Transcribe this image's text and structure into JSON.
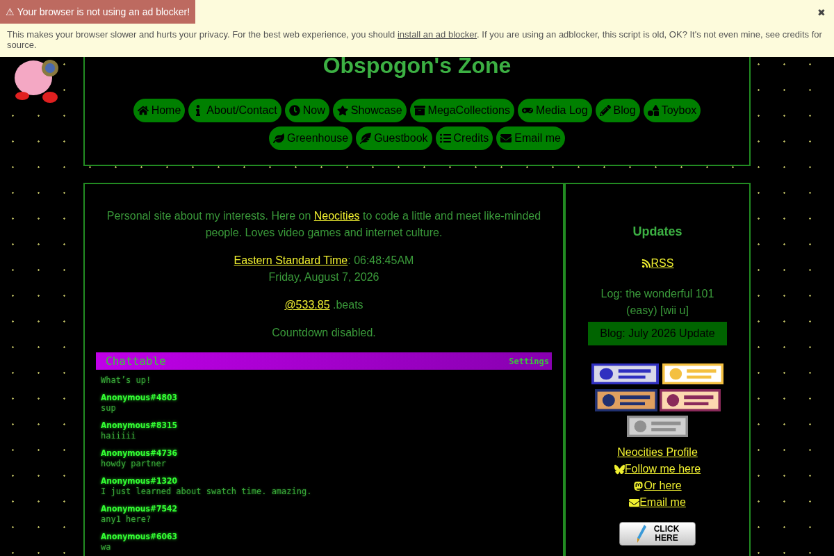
{
  "banner": {
    "title": "⚠ Your browser is not using an ad blocker!",
    "close": "✖",
    "text_before": "This makes your browser slower and hurts your privacy. For the best web experience, you should ",
    "link": "install an ad blocker",
    "text_after": ". If you are using an adblocker, this script is old, OK? It's not even mine, see credits for source."
  },
  "header": {
    "title": "Obspogon's Zone",
    "nav": [
      {
        "label": "Home"
      },
      {
        "label": "About/Contact"
      },
      {
        "label": "Now"
      },
      {
        "label": "Showcase"
      },
      {
        "label": "MegaCollections"
      },
      {
        "label": "Media Log"
      },
      {
        "label": "Blog"
      },
      {
        "label": "Toybox"
      },
      {
        "label": "Greenhouse"
      },
      {
        "label": "Guestbook"
      },
      {
        "label": "Credits"
      },
      {
        "label": "Email me"
      }
    ]
  },
  "main": {
    "intro_before": "Personal site about my interests. Here on ",
    "intro_link": "Neocities",
    "intro_after": " to code a little and meet like-minded people. Loves video games and internet culture.",
    "time_link": "Eastern Standard Time",
    "time": ": 06:48:45AM",
    "date": "Friday, August 7, 2026",
    "beats_link": "@533.85",
    "beats": ".beats",
    "countdown": "Countdown disabled.",
    "chat": {
      "title": "Chattable",
      "settings": "Settings",
      "messages": [
        {
          "text": "What’s up!"
        },
        {
          "name": "Anonymous#4803",
          "text": "sup"
        },
        {
          "name": "Anonymous#8315",
          "text": "haiiiii"
        },
        {
          "name": "Anonymous#4736",
          "text": "howdy partner"
        },
        {
          "name": "Anonymous#1320",
          "text": "I just learned about swatch time. amazing."
        },
        {
          "name": "Anonymous#7542",
          "text": "any1 here?"
        },
        {
          "name": "Anonymous#6063",
          "text": "wa"
        }
      ]
    }
  },
  "sidebar": {
    "title": "Updates",
    "rss": " RSS",
    "log": "Log: the wonderful 101 (easy) [wii u]",
    "blog": "Blog: July 2026 Update",
    "links": [
      {
        "label": "Neocities Profile"
      },
      {
        "label": " Follow me here"
      },
      {
        "label": " Or here"
      },
      {
        "label": " Email me"
      }
    ],
    "click_button": {
      "line1": "CLICK",
      "line2": "HERE"
    }
  }
}
